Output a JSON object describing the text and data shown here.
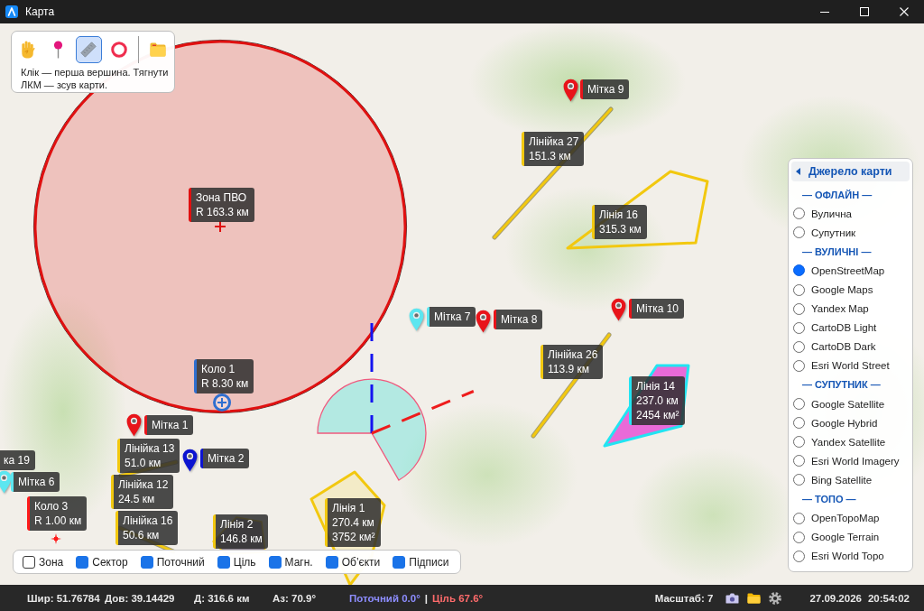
{
  "window": {
    "title": "Карта"
  },
  "toolbar": {
    "tools": [
      {
        "kind": "hand",
        "selected": false
      },
      {
        "kind": "pin",
        "selected": false
      },
      {
        "kind": "ruler",
        "selected": true
      },
      {
        "kind": "circle",
        "selected": false
      },
      {
        "kind": "folder",
        "selected": false
      }
    ],
    "hint": "Клік — перша вершина. Тягнути ЛКМ — зсув карти."
  },
  "map": {
    "circles": [
      {
        "kind": "zone",
        "title": "Зона ПВО",
        "radius": "R 163.3 км",
        "color": "#e01010"
      },
      {
        "kind": "ring",
        "title": "Коло 1",
        "radius": "R 8.30 км",
        "color": "#2f6fd0"
      },
      {
        "kind": "point",
        "title": "Коло 3",
        "radius": "R 1.00 км",
        "color": "#ff1a1a"
      }
    ],
    "markers": [
      {
        "label": "Мітка 9",
        "color": "#e8141a"
      },
      {
        "label": "Мітка 7",
        "color": "#5ce6f0"
      },
      {
        "label": "Мітка 8",
        "color": "#e8141a"
      },
      {
        "label": "Мітка 10",
        "color": "#e8141a"
      },
      {
        "label": "Мітка 1",
        "color": "#e8141a"
      },
      {
        "label": "Мітка 2",
        "color": "#0c14d0"
      },
      {
        "label": "Мітка 6",
        "color": "#5ce6f0"
      }
    ],
    "rulers": [
      {
        "label": "Лінійка 27",
        "distance": "151.3 км"
      },
      {
        "label": "Лінійка 26",
        "distance": "113.9 км"
      },
      {
        "label": "ка 19"
      },
      {
        "label": "Лінійка 13",
        "distance": "51.0 км"
      },
      {
        "label": "Лінійка 12",
        "distance": "24.5 км"
      },
      {
        "label": "Лінійка 16",
        "distance": "50.6 км"
      }
    ],
    "polygons": [
      {
        "label": "Лінія 16",
        "distance": "315.3 км",
        "color": "#f2c80f"
      },
      {
        "label": "Лінія 14",
        "distance": "237.0 км",
        "area": "2454 км²",
        "color": "#22e4f2"
      },
      {
        "label": "Лінія 2",
        "distance": "146.8 км",
        "color": "#f2c80f"
      },
      {
        "label": "Лінія 1",
        "distance": "270.4 км",
        "area": "3752 км²",
        "color": "#f2c80f"
      }
    ]
  },
  "source_panel": {
    "title": "Джерело карти",
    "groups": [
      {
        "heading": "— ОФЛАЙН —",
        "options": [
          {
            "label": "Вулична",
            "selected": false
          },
          {
            "label": "Супутник",
            "selected": false
          }
        ]
      },
      {
        "heading": "— ВУЛИЧНІ —",
        "options": [
          {
            "label": "OpenStreetMap",
            "selected": true
          },
          {
            "label": "Google Maps",
            "selected": false
          },
          {
            "label": "Yandex Map",
            "selected": false
          },
          {
            "label": "CartoDB Light",
            "selected": false
          },
          {
            "label": "CartoDB Dark",
            "selected": false
          },
          {
            "label": "Esri World Street",
            "selected": false
          }
        ]
      },
      {
        "heading": "— СУПУТНИК —",
        "options": [
          {
            "label": "Google Satellite",
            "selected": false
          },
          {
            "label": "Google Hybrid",
            "selected": false
          },
          {
            "label": "Yandex Satellite",
            "selected": false
          },
          {
            "label": "Esri World Imagery",
            "selected": false
          },
          {
            "label": "Bing Satellite",
            "selected": false
          }
        ]
      },
      {
        "heading": "— ТОПО —",
        "options": [
          {
            "label": "OpenTopoMap",
            "selected": false
          },
          {
            "label": "Google Terrain",
            "selected": false
          },
          {
            "label": "Esri World Topo",
            "selected": false
          }
        ]
      }
    ]
  },
  "layers_bar": {
    "items": [
      {
        "label": "Зона",
        "checked": false
      },
      {
        "label": "Сектор",
        "checked": true
      },
      {
        "label": "Поточний",
        "checked": true
      },
      {
        "label": "Ціль",
        "checked": true
      },
      {
        "label": "Магн.",
        "checked": true
      },
      {
        "label": "Об’єкти",
        "checked": true
      },
      {
        "label": "Підписи",
        "checked": true
      }
    ]
  },
  "status_bar": {
    "latitude": "Шир: 51.76784",
    "longitude": "Дов: 39.14429",
    "distance": "Д: 316.6 км",
    "azimuth": "Аз: 70.9°",
    "heading_current": "Поточний 0.0°",
    "separator": "|",
    "heading_target": "Ціль 67.6°",
    "zoom": "Масштаб: 7",
    "date": "27.09.2026",
    "time": "20:54:02"
  }
}
